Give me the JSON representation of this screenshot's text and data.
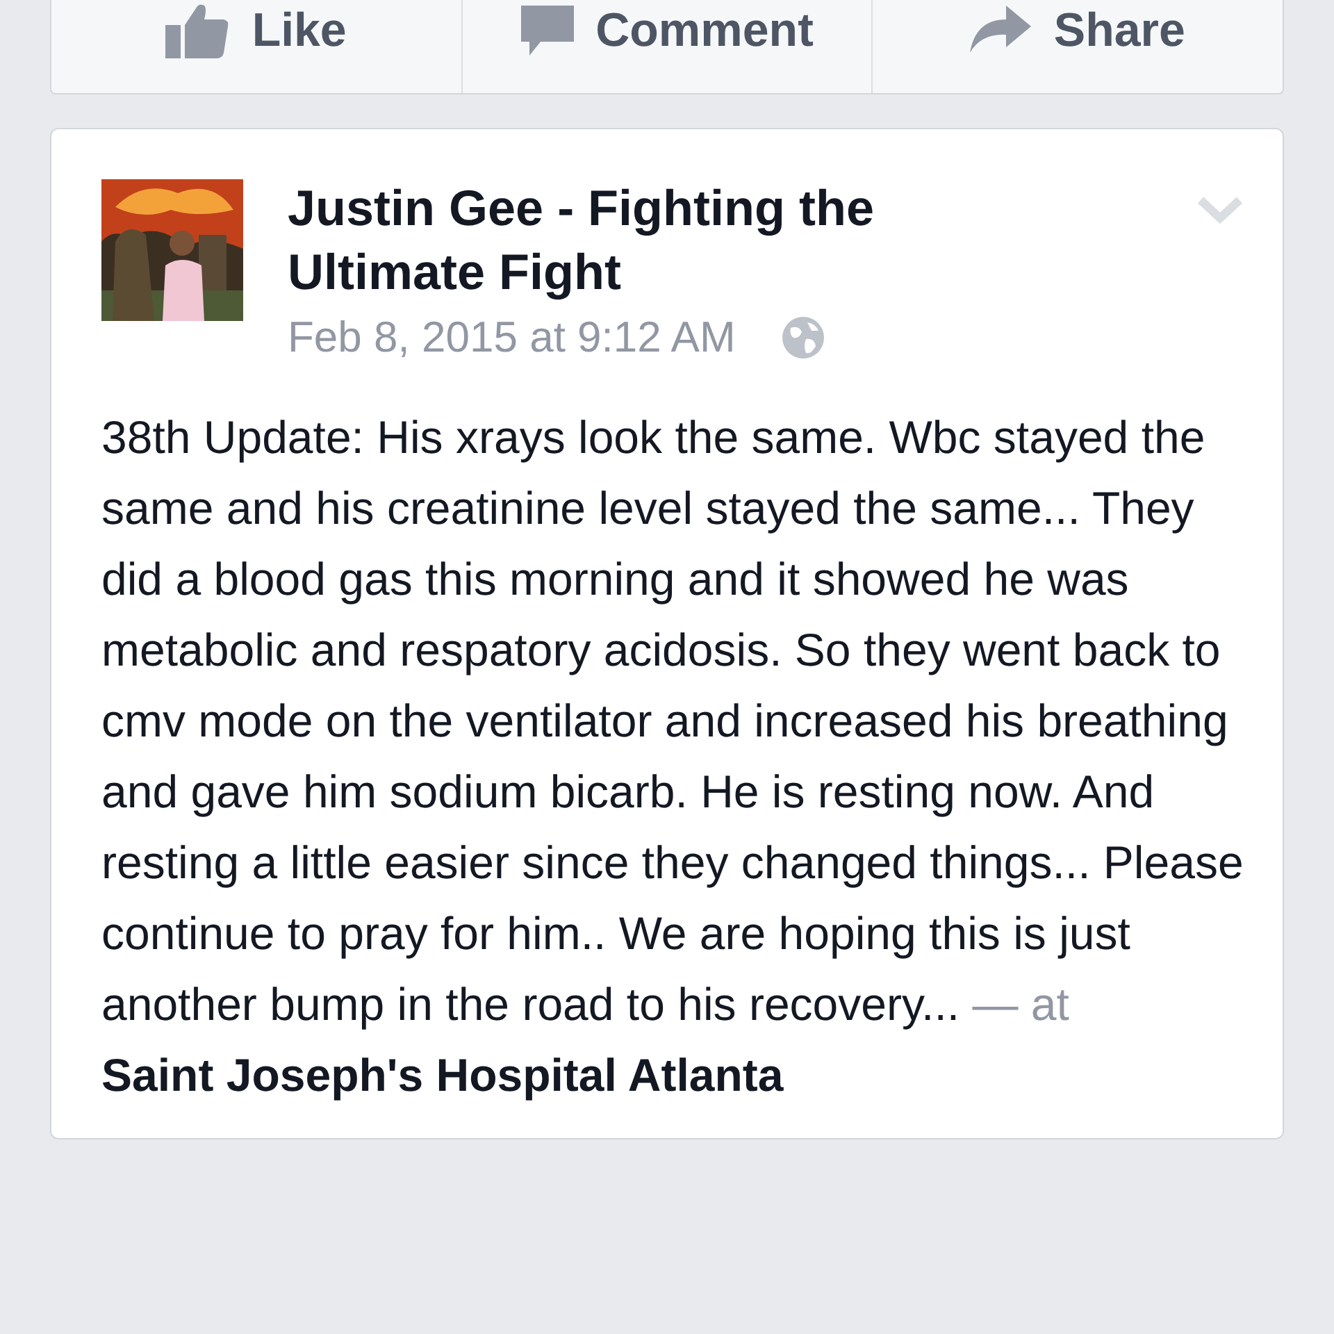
{
  "action_bar": [
    {
      "kind": "like",
      "label": "Like"
    },
    {
      "kind": "comment",
      "label": "Comment"
    },
    {
      "kind": "share",
      "label": "Share"
    }
  ],
  "post": {
    "author": "Justin Gee - Fighting the Ultimate Fight",
    "timestamp": "Feb 8, 2015 at 9:12 AM",
    "public": true,
    "body": "38th Update: His xrays look the same. Wbc stayed the same and his creatinine level stayed the same... They did a blood gas this morning and it showed he was metabolic and respatory acidosis. So they went back to cmv mode on the ventilator and increased his breathing and gave him sodium bicarb. He is resting now. And resting a little easier since they changed things... Please continue to pray for him.. We are hoping this is just another bump in the road to his recovery...",
    "location_prefix": "— at",
    "location": "Saint Joseph's Hospital Atlanta"
  }
}
